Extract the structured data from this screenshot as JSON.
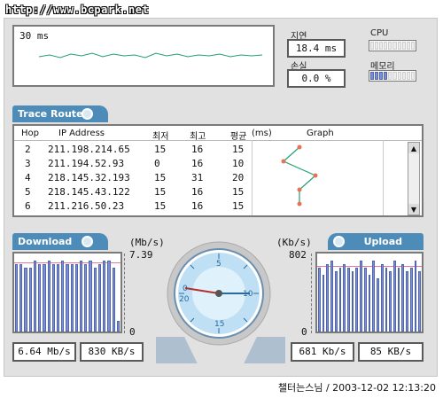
{
  "watermark": "http://www.bcpark.net",
  "ping": {
    "label": "30 ms"
  },
  "latency": {
    "label": "지연",
    "value": "18.4 ms"
  },
  "loss": {
    "label": "손실",
    "value": "0.0 %"
  },
  "cpu": {
    "label": "CPU",
    "level": 0.0
  },
  "memory": {
    "label": "메모리",
    "level": 0.4
  },
  "trace": {
    "title": "Trace Route",
    "headers": {
      "hop": "Hop",
      "ip": "IP Address",
      "min": "최저",
      "max": "최고",
      "avg": "평균",
      "unit": "(ms)",
      "graph": "Graph"
    },
    "rows": [
      {
        "hop": "2",
        "ip": "211.198.214.65",
        "min": "15",
        "max": "16",
        "avg": "15"
      },
      {
        "hop": "3",
        "ip": "211.194.52.93",
        "min": "0",
        "max": "16",
        "avg": "10"
      },
      {
        "hop": "4",
        "ip": "218.145.32.193",
        "min": "15",
        "max": "31",
        "avg": "20"
      },
      {
        "hop": "5",
        "ip": "218.145.43.122",
        "min": "15",
        "max": "16",
        "avg": "15"
      },
      {
        "hop": "6",
        "ip": "211.216.50.23",
        "min": "15",
        "max": "16",
        "avg": "15"
      }
    ]
  },
  "download": {
    "title": "Download",
    "unit": "(Mb/s)",
    "max": "7.39",
    "zero": "0",
    "mbps": "6.64 Mb/s",
    "kbps": "830 KB/s",
    "bars": [
      0.95,
      0.95,
      0.9,
      0.9,
      1.0,
      0.95,
      0.95,
      1.0,
      0.95,
      0.95,
      1.0,
      0.95,
      0.95,
      0.95,
      1.0,
      0.95,
      1.0,
      0.9,
      0.95,
      1.0,
      1.0,
      0.9,
      0.15
    ]
  },
  "upload": {
    "title": "Upload",
    "unit": "(Kb/s)",
    "max": "802",
    "zero": "0",
    "kbps": "681 Kb/s",
    "kBps": "85 KB/s",
    "bars": [
      0.9,
      0.8,
      0.95,
      1.0,
      0.85,
      0.9,
      0.95,
      0.9,
      0.85,
      0.9,
      1.0,
      0.9,
      0.8,
      1.0,
      0.75,
      0.95,
      0.9,
      0.85,
      1.0,
      0.9,
      0.95,
      0.85,
      0.9,
      1.0,
      0.85
    ]
  },
  "gauge": {
    "ticks": [
      "5",
      "10",
      "15",
      "20",
      "0"
    ]
  },
  "credit": "챌터는스님 / 2003-12-02 12:13:20",
  "colors": {
    "accent": "#4d8cb8",
    "bar": "#7b8fd4",
    "line": "#20a070",
    "avg": "#e37a9a"
  }
}
